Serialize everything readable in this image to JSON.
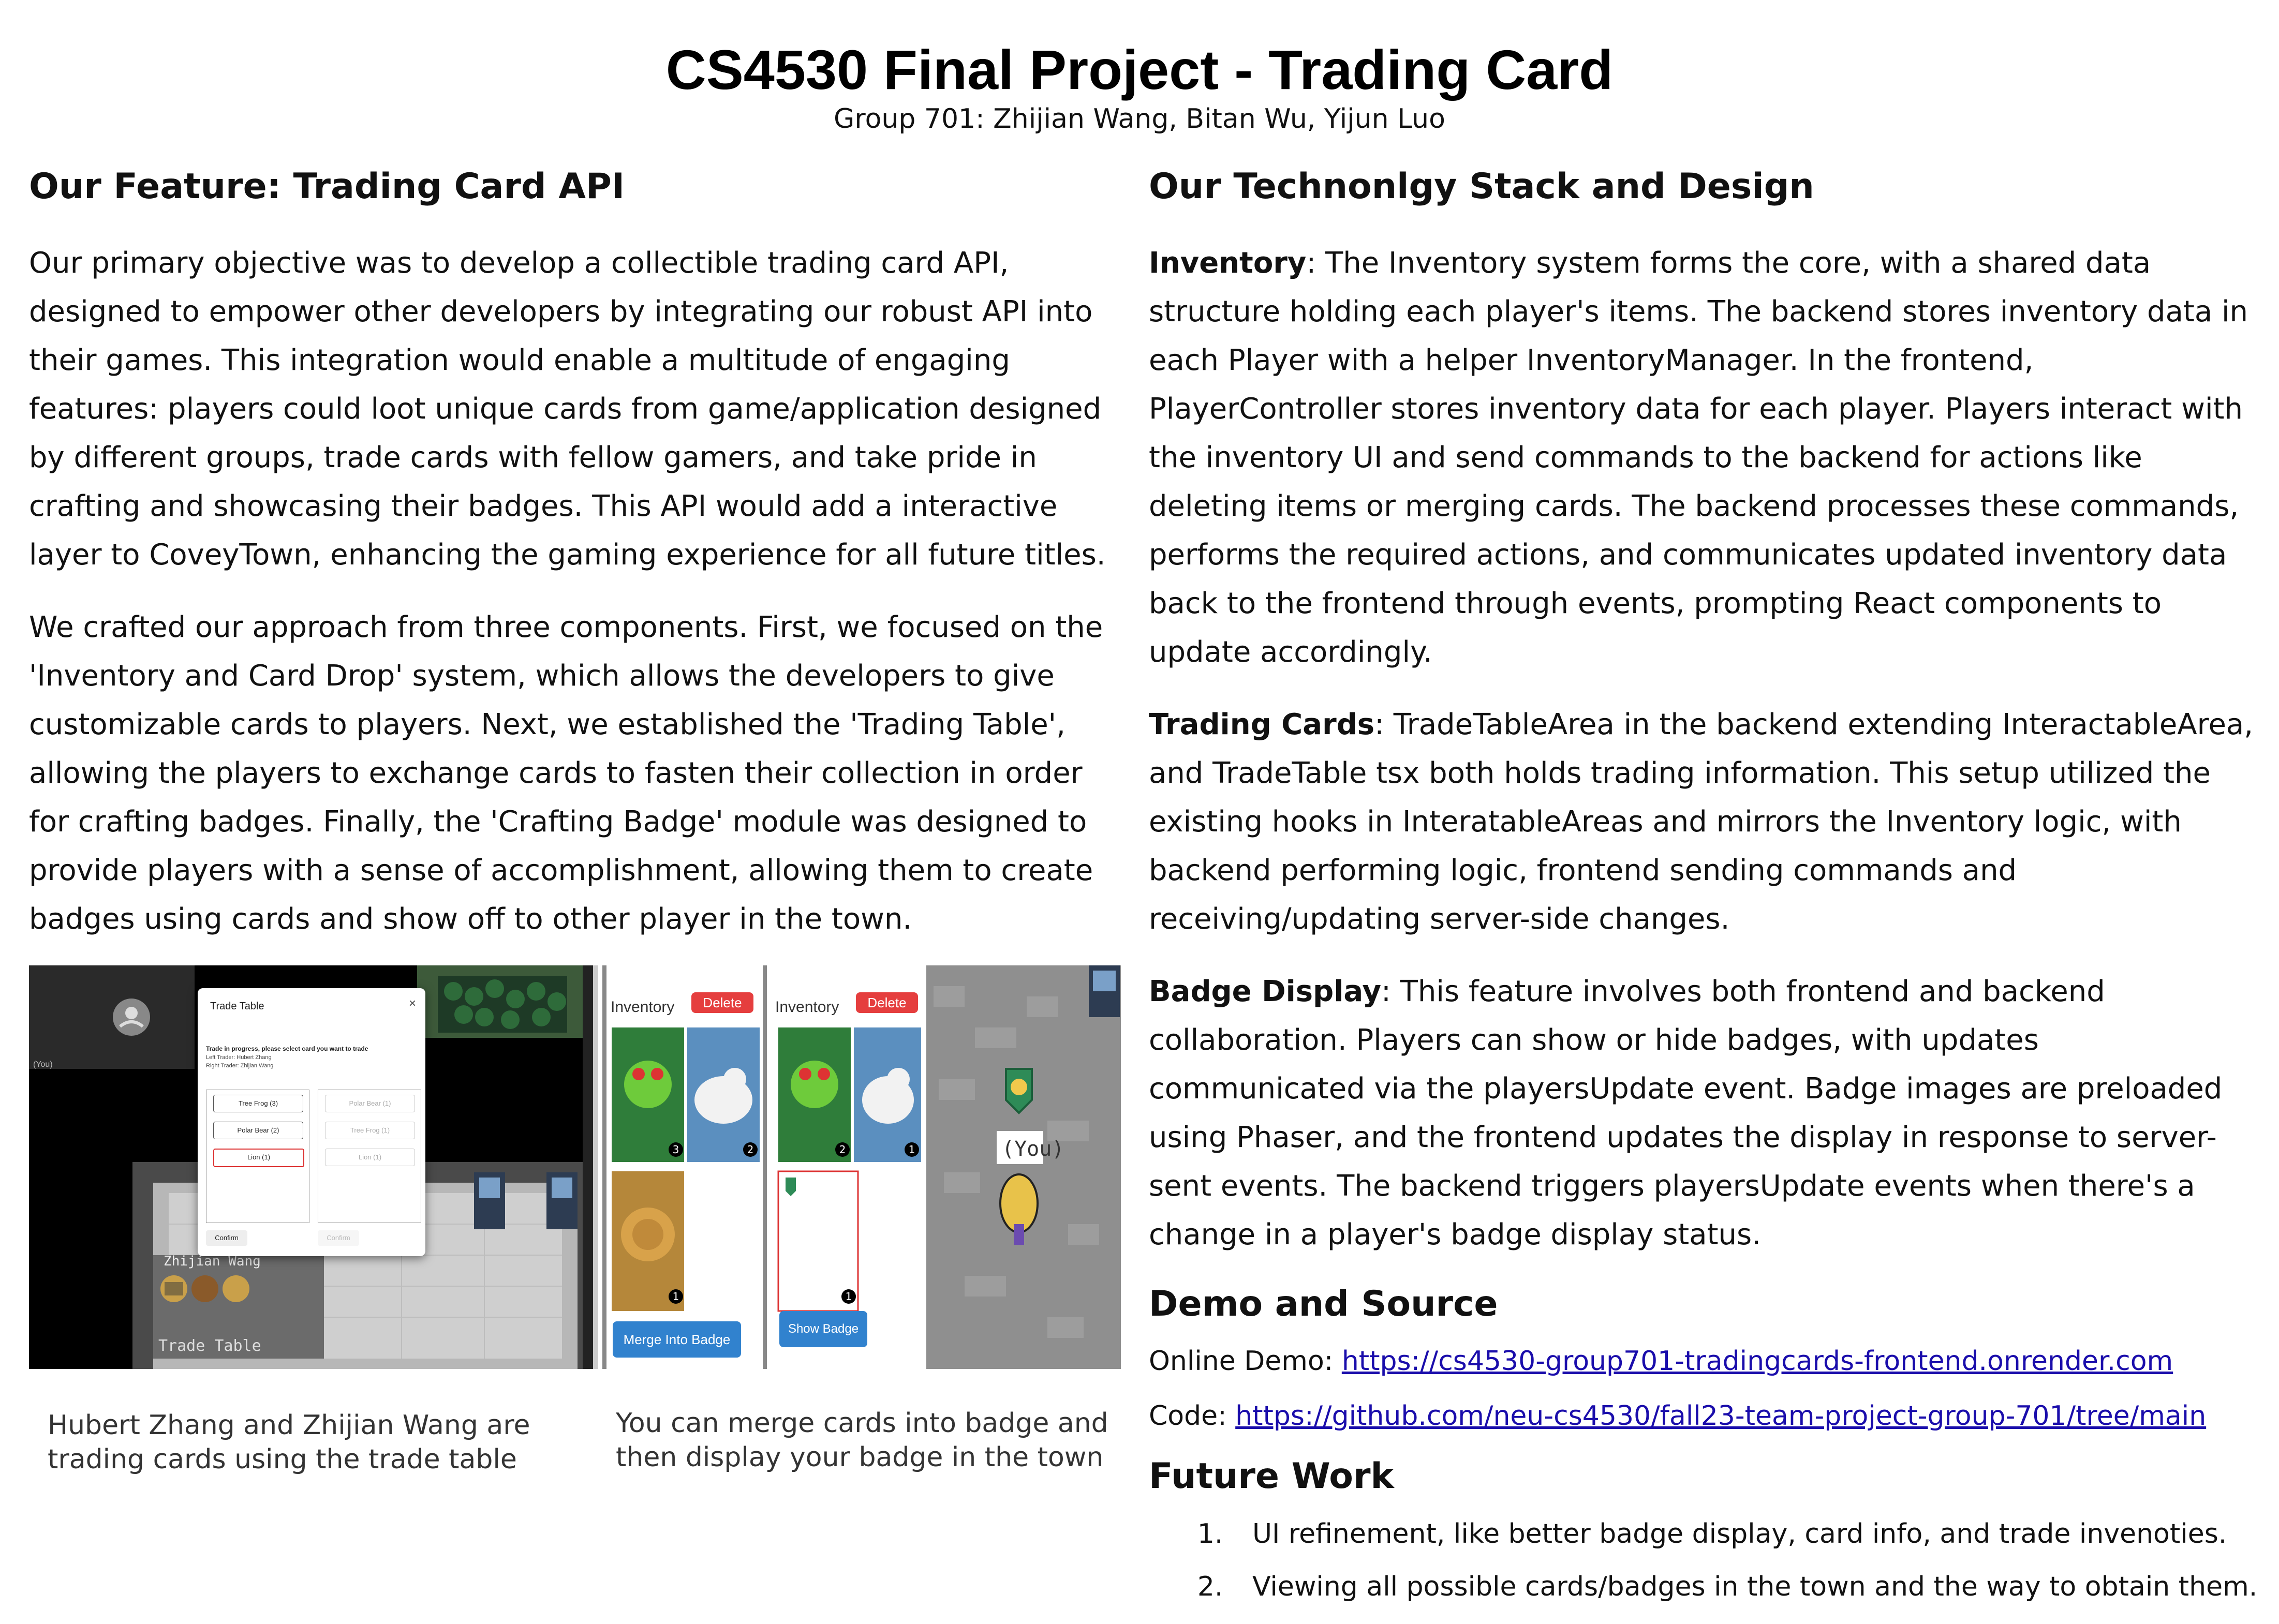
{
  "header": {
    "title": "CS4530 Final Project - Trading Card",
    "subtitle": "Group 701: Zhijian Wang, Bitan Wu, Yijun Luo"
  },
  "left": {
    "heading": "Our Feature: Trading Card API",
    "p1": "Our primary objective was to develop a collectible trading card API, designed to empower other developers by integrating our robust API into their games. This integration would enable a multitude of engaging features: players could loot unique cards from game/application designed by different groups, trade cards with fellow gamers, and take pride in crafting and showcasing their badges. This API would add a interactive layer to CoveyTown, enhancing the gaming experience for all future titles.",
    "p2": "We crafted our approach from three components. First, we focused on the 'Inventory and Card Drop' system, which allows the developers to give customizable cards to players. Next, we established the 'Trading Table', allowing the players to exchange cards to fasten their collection in order for crafting badges. Finally, the 'Crafting Badge' module was designed to provide players with a sense of accomplishment, allowing them to create badges using cards and show off to other player in the town.",
    "caption1": "Hubert Zhang and Zhijian Wang are trading cards using the trade table",
    "caption2": "You can merge cards into badge and then display your badge in the town"
  },
  "figure1": {
    "dialog_title": "Trade Table",
    "close_glyph": "×",
    "instruction": "Trade in progress, please select card you want to trade",
    "left_trader": "Left Trader: Hubert Zhang",
    "right_trader": "Right Trader: Zhijian Wang",
    "left_cards": [
      "Tree Frog (3)",
      "Polar Bear (2)",
      "Lion (1)"
    ],
    "right_cards": [
      "Polar Bear (1)",
      "Tree Frog (1)",
      "Lion (1)"
    ],
    "confirm_left": "Confirm",
    "confirm_right": "Confirm",
    "you_label": "(You)",
    "player_name": "Zhijian Wang",
    "table_label": "Trade Table"
  },
  "figure2": {
    "inventory_label_a": "Inventory",
    "inventory_label_b": "Inventory",
    "delete_a": "Delete",
    "delete_b": "Delete",
    "counts_a": [
      "3",
      "2",
      "1"
    ],
    "counts_b": [
      "2",
      "1",
      "1"
    ],
    "merge_button": "Merge Into Badge",
    "show_button": "Show Badge",
    "you_tag": "(You)"
  },
  "right": {
    "heading": "Our Technonlgy Stack and Design",
    "inv_label": "Inventory",
    "inv_text": ": The Inventory system forms the core, with a shared data structure holding each player's items. The backend stores inventory data in each Player with a helper InventoryManager. In the frontend, PlayerController stores inventory data for each player. Players interact with the inventory UI and send commands to the backend for actions like deleting items or merging cards. The backend processes these commands, performs the required actions, and communicates updated inventory data back to the frontend through events, prompting React components to update accordingly.",
    "tc_label": "Trading Cards",
    "tc_text": ": TradeTableArea in the backend extending InteractableArea, and TradeTable tsx both holds trading information. This setup utilized the existing hooks in InteratableAreas and mirrors the Inventory logic, with backend performing logic, frontend sending commands and receiving/updating server-side changes.",
    "bd_label": "Badge Display",
    "bd_text": ": This feature involves both frontend and backend collaboration. Players can show or hide badges, with updates communicated via the playersUpdate event. Badge images are preloaded using Phaser, and the frontend updates the display in response to server-sent events. The backend triggers playersUpdate events when there's a change in a player's badge display status.",
    "demo_heading": "Demo and Source",
    "demo_prefix": "Online Demo: ",
    "demo_link": "https://cs4530-group701-tradingcards-frontend.onrender.com",
    "code_prefix": "Code: ",
    "code_link": "https://github.com/neu-cs4530/fall23-team-project-group-701/tree/main",
    "future_heading": "Future Work",
    "future_items": [
      "UI refinement, like better badge display, card info, and trade invenoties.",
      "Viewing all possible cards/badges in the town and the way to obtain them."
    ]
  }
}
